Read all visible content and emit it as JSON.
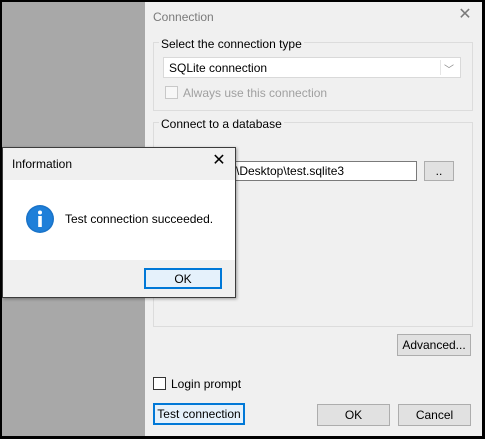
{
  "dialog": {
    "title": "Connection",
    "connection_type_group": "Select the connection type",
    "connection_type_value": "SQLite connection",
    "always_use_label": "Always use this connection",
    "connect_group": "Connect to a database",
    "database_path": "\\Desktop\\test.sqlite3",
    "browse_label": "..",
    "advanced_label": "Advanced...",
    "login_prompt_label": "Login prompt",
    "test_connection_label": "Test connection",
    "ok_label": "OK",
    "cancel_label": "Cancel"
  },
  "messagebox": {
    "title": "Information",
    "message": "Test connection succeeded.",
    "ok_label": "OK",
    "icon": "info-icon"
  },
  "colors": {
    "accent": "#0078d7",
    "dialog_bg": "#f0f0f0",
    "background_grey": "#a8a8a8"
  }
}
